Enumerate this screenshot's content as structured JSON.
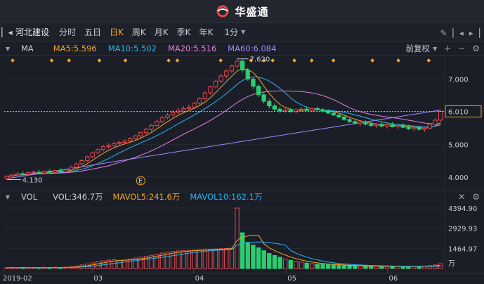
{
  "app": {
    "brand": "华盛通"
  },
  "toolbar": {
    "stock_name": "河北建设",
    "periods": [
      {
        "label": "分时",
        "active": false
      },
      {
        "label": "五日",
        "active": false
      },
      {
        "label": "日K",
        "active": true
      },
      {
        "label": "周K",
        "active": false
      },
      {
        "label": "月K",
        "active": false
      },
      {
        "label": "季K",
        "active": false
      },
      {
        "label": "年K",
        "active": false
      }
    ],
    "minute_select": "1分"
  },
  "main_legend": {
    "indicator": "MA",
    "items": [
      {
        "label": "MA5:5.596",
        "color": "#f5a623"
      },
      {
        "label": "MA10:5.502",
        "color": "#2ab3f0"
      },
      {
        "label": "MA20:5.516",
        "color": "#e57fe0"
      },
      {
        "label": "MA60:6.084",
        "color": "#9b8bff"
      }
    ],
    "adjust": "前复权"
  },
  "vol_legend": {
    "indicator": "VOL",
    "items": [
      {
        "label": "VOL:346.7万",
        "color": "#c8ccd4"
      },
      {
        "label": "MAVOL5:241.6万",
        "color": "#f5a623"
      },
      {
        "label": "MAVOL10:162.1万",
        "color": "#2ab3f0"
      }
    ]
  },
  "colors": {
    "up": "#e5484d",
    "down": "#2ecc71",
    "marker": "#f5a623",
    "current": "#f5a623"
  },
  "chart_data": {
    "type": "candlestick",
    "price_axis": {
      "ticks": [
        "7.000",
        "6.000",
        "5.000",
        "4.000"
      ],
      "ylim": [
        3.65,
        7.7
      ]
    },
    "current_price": "6.010",
    "high_label": "7.620",
    "low_label": "4.130",
    "event_marker": "E",
    "x_ticks": [
      "2019-02",
      "03",
      "04",
      "05",
      "06"
    ],
    "volume_axis": {
      "ticks": [
        "4394.90",
        "2929.93",
        "1464.97"
      ],
      "unit": "万",
      "ylim": [
        0,
        4700
      ]
    },
    "ohlc": [
      [
        3.95,
        4.05,
        3.92,
        4.02
      ],
      [
        4.02,
        4.1,
        3.98,
        4.06
      ],
      [
        4.06,
        4.15,
        4.02,
        4.1
      ],
      [
        4.1,
        4.18,
        4.05,
        4.08
      ],
      [
        4.08,
        4.16,
        4.04,
        4.13
      ],
      [
        4.13,
        4.2,
        4.08,
        4.15
      ],
      [
        4.15,
        4.22,
        4.1,
        4.12
      ],
      [
        4.12,
        4.2,
        4.08,
        4.18
      ],
      [
        4.18,
        4.25,
        4.12,
        4.14
      ],
      [
        4.14,
        4.22,
        4.1,
        4.2
      ],
      [
        4.2,
        4.28,
        4.15,
        4.16
      ],
      [
        4.16,
        4.24,
        4.12,
        4.22
      ],
      [
        4.22,
        4.35,
        4.18,
        4.3
      ],
      [
        4.3,
        4.45,
        4.25,
        4.4
      ],
      [
        4.4,
        4.55,
        4.35,
        4.5
      ],
      [
        4.5,
        4.65,
        4.45,
        4.62
      ],
      [
        4.62,
        4.78,
        4.58,
        4.74
      ],
      [
        4.74,
        4.88,
        4.68,
        4.84
      ],
      [
        4.84,
        4.98,
        4.78,
        4.93
      ],
      [
        4.93,
        5.05,
        4.86,
        4.96
      ],
      [
        4.96,
        5.08,
        4.9,
        5.02
      ],
      [
        5.02,
        5.12,
        4.96,
        5.06
      ],
      [
        5.06,
        5.15,
        5.0,
        5.1
      ],
      [
        5.1,
        5.22,
        5.04,
        5.18
      ],
      [
        5.18,
        5.3,
        5.12,
        5.26
      ],
      [
        5.26,
        5.4,
        5.2,
        5.36
      ],
      [
        5.36,
        5.5,
        5.3,
        5.46
      ],
      [
        5.46,
        5.62,
        5.4,
        5.58
      ],
      [
        5.58,
        5.75,
        5.52,
        5.7
      ],
      [
        5.7,
        5.88,
        5.64,
        5.82
      ],
      [
        5.82,
        5.96,
        5.76,
        5.9
      ],
      [
        5.9,
        6.05,
        5.84,
        5.98
      ],
      [
        5.98,
        6.12,
        5.92,
        6.05
      ],
      [
        6.05,
        6.18,
        5.98,
        6.1
      ],
      [
        6.1,
        6.22,
        6.02,
        6.14
      ],
      [
        6.14,
        6.3,
        6.08,
        6.26
      ],
      [
        6.26,
        6.45,
        6.2,
        6.4
      ],
      [
        6.4,
        6.62,
        6.35,
        6.58
      ],
      [
        6.58,
        6.8,
        6.52,
        6.76
      ],
      [
        6.76,
        6.98,
        6.7,
        6.94
      ],
      [
        6.94,
        7.15,
        6.88,
        7.1
      ],
      [
        7.1,
        7.3,
        7.02,
        7.25
      ],
      [
        7.25,
        7.45,
        7.18,
        7.4
      ],
      [
        7.4,
        7.62,
        7.32,
        7.55
      ],
      [
        7.55,
        7.6,
        7.2,
        7.28
      ],
      [
        7.28,
        7.35,
        6.95,
        7.0
      ],
      [
        7.0,
        7.05,
        6.7,
        6.78
      ],
      [
        6.78,
        6.85,
        6.45,
        6.52
      ],
      [
        6.52,
        6.6,
        6.25,
        6.32
      ],
      [
        6.32,
        6.4,
        6.1,
        6.18
      ],
      [
        6.18,
        6.26,
        6.0,
        6.08
      ],
      [
        6.08,
        6.15,
        5.95,
        6.02
      ],
      [
        6.02,
        6.12,
        5.96,
        6.05
      ],
      [
        6.05,
        6.12,
        5.98,
        6.0
      ],
      [
        6.0,
        6.1,
        5.94,
        6.06
      ],
      [
        6.06,
        6.14,
        6.0,
        6.08
      ],
      [
        6.08,
        6.16,
        6.02,
        6.04
      ],
      [
        6.04,
        6.12,
        5.98,
        6.1
      ],
      [
        6.1,
        6.16,
        6.02,
        6.06
      ],
      [
        6.06,
        6.12,
        5.98,
        6.02
      ],
      [
        6.02,
        6.08,
        5.92,
        5.96
      ],
      [
        5.96,
        6.02,
        5.86,
        5.9
      ],
      [
        5.9,
        5.96,
        5.8,
        5.84
      ],
      [
        5.84,
        5.9,
        5.72,
        5.76
      ],
      [
        5.76,
        5.84,
        5.66,
        5.7
      ],
      [
        5.7,
        5.78,
        5.6,
        5.64
      ],
      [
        5.64,
        5.72,
        5.56,
        5.68
      ],
      [
        5.68,
        5.74,
        5.58,
        5.62
      ],
      [
        5.62,
        5.7,
        5.54,
        5.58
      ],
      [
        5.58,
        5.66,
        5.5,
        5.62
      ],
      [
        5.62,
        5.7,
        5.52,
        5.56
      ],
      [
        5.56,
        5.64,
        5.48,
        5.6
      ],
      [
        5.6,
        5.68,
        5.52,
        5.54
      ],
      [
        5.54,
        5.62,
        5.46,
        5.58
      ],
      [
        5.58,
        5.66,
        5.5,
        5.52
      ],
      [
        5.52,
        5.6,
        5.44,
        5.48
      ],
      [
        5.48,
        5.56,
        5.4,
        5.52
      ],
      [
        5.52,
        5.58,
        5.42,
        5.46
      ],
      [
        5.46,
        5.54,
        5.38,
        5.5
      ],
      [
        5.5,
        5.66,
        5.46,
        5.62
      ],
      [
        5.62,
        5.8,
        5.56,
        5.74
      ],
      [
        5.74,
        6.05,
        5.7,
        6.01
      ]
    ],
    "volume": [
      60,
      70,
      55,
      80,
      65,
      75,
      60,
      85,
      70,
      90,
      75,
      95,
      130,
      180,
      260,
      330,
      420,
      500,
      560,
      610,
      640,
      600,
      620,
      680,
      760,
      820,
      900,
      960,
      1040,
      1120,
      1180,
      1240,
      1280,
      1300,
      1320,
      1340,
      1360,
      1380,
      1400,
      1420,
      1440,
      1460,
      1480,
      4394.9,
      2600,
      1900,
      1700,
      1500,
      1300,
      1100,
      950,
      820,
      700,
      600,
      520,
      460,
      400,
      360,
      320,
      300,
      280,
      260,
      240,
      220,
      210,
      200,
      190,
      180,
      175,
      170,
      165,
      160,
      155,
      150,
      145,
      140,
      150,
      160,
      175,
      210,
      260,
      346.7
    ],
    "marker_positions": [
      0.0,
      0.09,
      0.13,
      0.2,
      0.26,
      0.36,
      0.38,
      0.48,
      0.55,
      0.58,
      0.6,
      0.65,
      0.69,
      0.74,
      0.83,
      0.89,
      0.96
    ]
  }
}
